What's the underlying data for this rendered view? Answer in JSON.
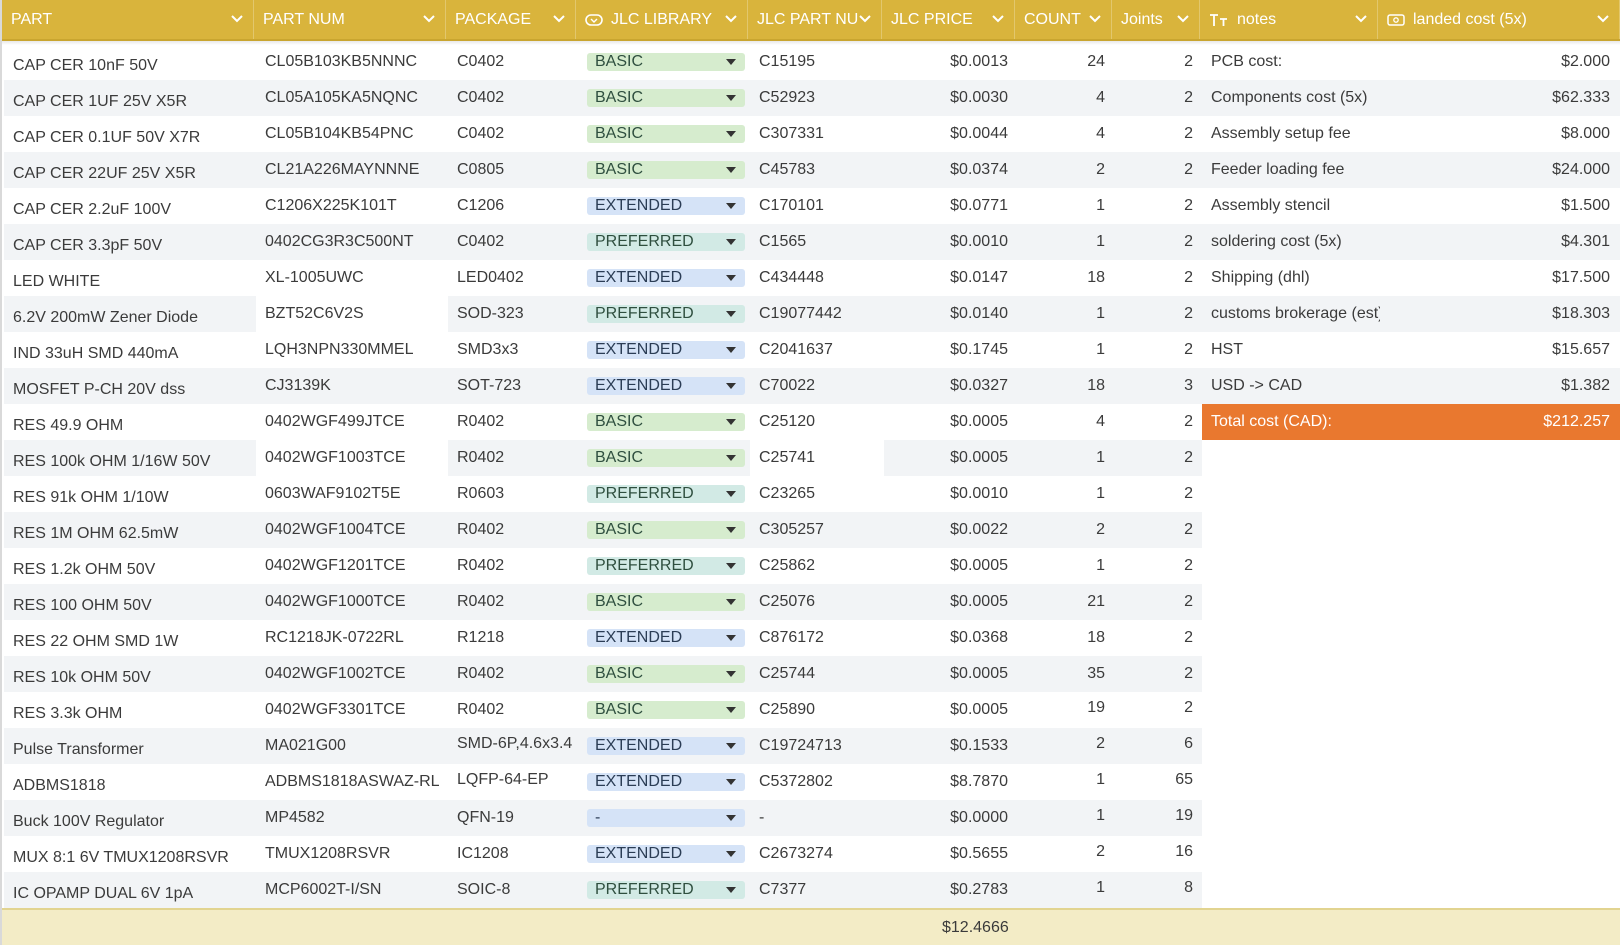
{
  "colors": {
    "header_bg": "#d9b43c",
    "total_row_bg": "#f3ecc6",
    "highlight": "#e9782f",
    "basic": "#d6ecce",
    "extended": "#d5e3f7",
    "preferred": "#d2eae5"
  },
  "columns": [
    {
      "label": "PART",
      "icon": ""
    },
    {
      "label": "PART NUM",
      "icon": ""
    },
    {
      "label": "PACKAGE",
      "icon": ""
    },
    {
      "label": "JLC LIBRARY",
      "icon": "dropdown-type-icon"
    },
    {
      "label": "JLC PART NU",
      "icon": ""
    },
    {
      "label": "JLC PRICE",
      "icon": ""
    },
    {
      "label": "COUNT",
      "icon": ""
    },
    {
      "label": "Joints",
      "icon": ""
    },
    {
      "label": "notes",
      "icon": "text-type-icon"
    },
    {
      "label": "landed cost (5x)",
      "icon": "currency-type-icon"
    }
  ],
  "rows": [
    {
      "part": "CAP CER 10nF 50V",
      "part_num": "CL05B103KB5NNNC",
      "package": "C0402",
      "library": "BASIC",
      "jlc_part": "C15195",
      "price": "$0.0013",
      "count": "24",
      "joints": "2"
    },
    {
      "part": "CAP CER 1UF 25V X5R",
      "part_num": "CL05A105KA5NQNC",
      "package": "C0402",
      "library": "BASIC",
      "jlc_part": "C52923",
      "price": "$0.0030",
      "count": "4",
      "joints": "2"
    },
    {
      "part": "CAP CER 0.1UF 50V X7R",
      "part_num": "CL05B104KB54PNC",
      "package": "C0402",
      "library": "BASIC",
      "jlc_part": "C307331",
      "price": "$0.0044",
      "count": "4",
      "joints": "2"
    },
    {
      "part": "CAP CER 22UF 25V X5R",
      "part_num": "CL21A226MAYNNNE",
      "package": "C0805",
      "library": "BASIC",
      "jlc_part": "C45783",
      "price": "$0.0374",
      "count": "2",
      "joints": "2"
    },
    {
      "part": "CAP CER 2.2uF 100V",
      "part_num": "C1206X225K101T",
      "package": "C1206",
      "library": "EXTENDED",
      "jlc_part": "C170101",
      "price": "$0.0771",
      "count": "1",
      "joints": "2"
    },
    {
      "part": "CAP CER 3.3pF 50V",
      "part_num": "0402CG3R3C500NT",
      "package": "C0402",
      "library": "PREFERRED",
      "jlc_part": "C1565",
      "price": "$0.0010",
      "count": "1",
      "joints": "2"
    },
    {
      "part": "LED WHITE",
      "part_num": "XL-1005UWC",
      "package": "LED0402",
      "library": "EXTENDED",
      "jlc_part": "C434448",
      "price": "$0.0147",
      "count": "18",
      "joints": "2"
    },
    {
      "part": "6.2V 200mW Zener Diode",
      "part_num": "BZT52C6V2S",
      "package": "SOD-323",
      "library": "PREFERRED",
      "jlc_part": "C19077442",
      "price": "$0.0140",
      "count": "1",
      "joints": "2"
    },
    {
      "part": "IND 33uH SMD 440mA",
      "part_num": "LQH3NPN330MMEL",
      "package": "SMD3x3",
      "library": "EXTENDED",
      "jlc_part": "C2041637",
      "price": "$0.1745",
      "count": "1",
      "joints": "2"
    },
    {
      "part": "MOSFET P-CH 20V dss",
      "part_num": "CJ3139K",
      "package": "SOT-723",
      "library": "EXTENDED",
      "jlc_part": "C70022",
      "price": "$0.0327",
      "count": "18",
      "joints": "3"
    },
    {
      "part": "RES 49.9 OHM",
      "part_num": "0402WGF499JTCE",
      "package": "R0402",
      "library": "BASIC",
      "jlc_part": "C25120",
      "price": "$0.0005",
      "count": "4",
      "joints": "2"
    },
    {
      "part": "RES 100k OHM 1/16W 50V",
      "part_num": "0402WGF1003TCE",
      "package": "R0402",
      "library": "BASIC",
      "jlc_part": "C25741",
      "price": "$0.0005",
      "count": "1",
      "joints": "2"
    },
    {
      "part": "RES 91k OHM 1/10W",
      "part_num": "0603WAF9102T5E",
      "package": "R0603",
      "library": "PREFERRED",
      "jlc_part": "C23265",
      "price": "$0.0010",
      "count": "1",
      "joints": "2"
    },
    {
      "part": "RES 1M OHM 62.5mW",
      "part_num": "0402WGF1004TCE",
      "package": "R0402",
      "library": "BASIC",
      "jlc_part": "C305257",
      "price": "$0.0022",
      "count": "2",
      "joints": "2"
    },
    {
      "part": "RES 1.2k OHM 50V",
      "part_num": "0402WGF1201TCE",
      "package": "R0402",
      "library": "PREFERRED",
      "jlc_part": "C25862",
      "price": "$0.0005",
      "count": "1",
      "joints": "2"
    },
    {
      "part": "RES 100 OHM 50V",
      "part_num": "0402WGF1000TCE",
      "package": "R0402",
      "library": "BASIC",
      "jlc_part": "C25076",
      "price": "$0.0005",
      "count": "21",
      "joints": "2"
    },
    {
      "part": "RES 22 OHM SMD 1W",
      "part_num": "RC1218JK-0722RL",
      "package": "R1218",
      "library": "EXTENDED",
      "jlc_part": "C876172",
      "price": "$0.0368",
      "count": "18",
      "joints": "2"
    },
    {
      "part": "RES 10k OHM 50V",
      "part_num": "0402WGF1002TCE",
      "package": "R0402",
      "library": "BASIC",
      "jlc_part": "C25744",
      "price": "$0.0005",
      "count": "35",
      "joints": "2"
    },
    {
      "part": "RES 3.3k OHM",
      "part_num": "0402WGF3301TCE",
      "package": "R0402",
      "library": "BASIC",
      "jlc_part": "C25890",
      "price": "$0.0005",
      "count": "19",
      "joints": "2"
    },
    {
      "part": "Pulse Transformer",
      "part_num": "MA021G00",
      "package": "SMD-6P,4.6x3.4",
      "library": "EXTENDED",
      "jlc_part": "C19724713",
      "price": "$0.1533",
      "count": "2",
      "joints": "6"
    },
    {
      "part": "ADBMS1818",
      "part_num": "ADBMS1818ASWAZ-RL",
      "package": "LQFP-64-EP",
      "library": "EXTENDED",
      "jlc_part": "C5372802",
      "price": "$8.7870",
      "count": "1",
      "joints": "65"
    },
    {
      "part": "Buck 100V Regulator",
      "part_num": "MP4582",
      "package": "QFN-19",
      "library": "-",
      "jlc_part": "-",
      "price": "$0.0000",
      "count": "1",
      "joints": "19"
    },
    {
      "part": "MUX 8:1 6V TMUX1208RSVR",
      "part_num": "TMUX1208RSVR",
      "package": "IC1208",
      "library": "EXTENDED",
      "jlc_part": "C2673274",
      "price": "$0.5655",
      "count": "2",
      "joints": "16"
    },
    {
      "part": "IC OPAMP DUAL 6V 1pA",
      "part_num": "MCP6002T-I/SN",
      "package": "SOIC-8",
      "library": "PREFERRED",
      "jlc_part": "C7377",
      "price": "$0.2783",
      "count": "1",
      "joints": "8"
    }
  ],
  "summary": [
    {
      "label": "PCB cost:",
      "value": "$2.000"
    },
    {
      "label": "Components cost (5x)",
      "value": "$62.333"
    },
    {
      "label": "Assembly setup fee",
      "value": "$8.000"
    },
    {
      "label": "Feeder loading fee",
      "value": "$24.000"
    },
    {
      "label": "Assembly stencil",
      "value": "$1.500"
    },
    {
      "label": "soldering cost (5x)",
      "value": "$4.301"
    },
    {
      "label": "Shipping (dhl)",
      "value": "$17.500"
    },
    {
      "label": "customs brokerage (est)",
      "value": "$18.303"
    },
    {
      "label": "HST",
      "value": "$15.657"
    },
    {
      "label": "USD -> CAD",
      "value": "$1.382"
    },
    {
      "label": "Total cost (CAD):",
      "value": "$212.257",
      "highlight": true
    }
  ],
  "footer": {
    "price_total": "$12.4666"
  }
}
